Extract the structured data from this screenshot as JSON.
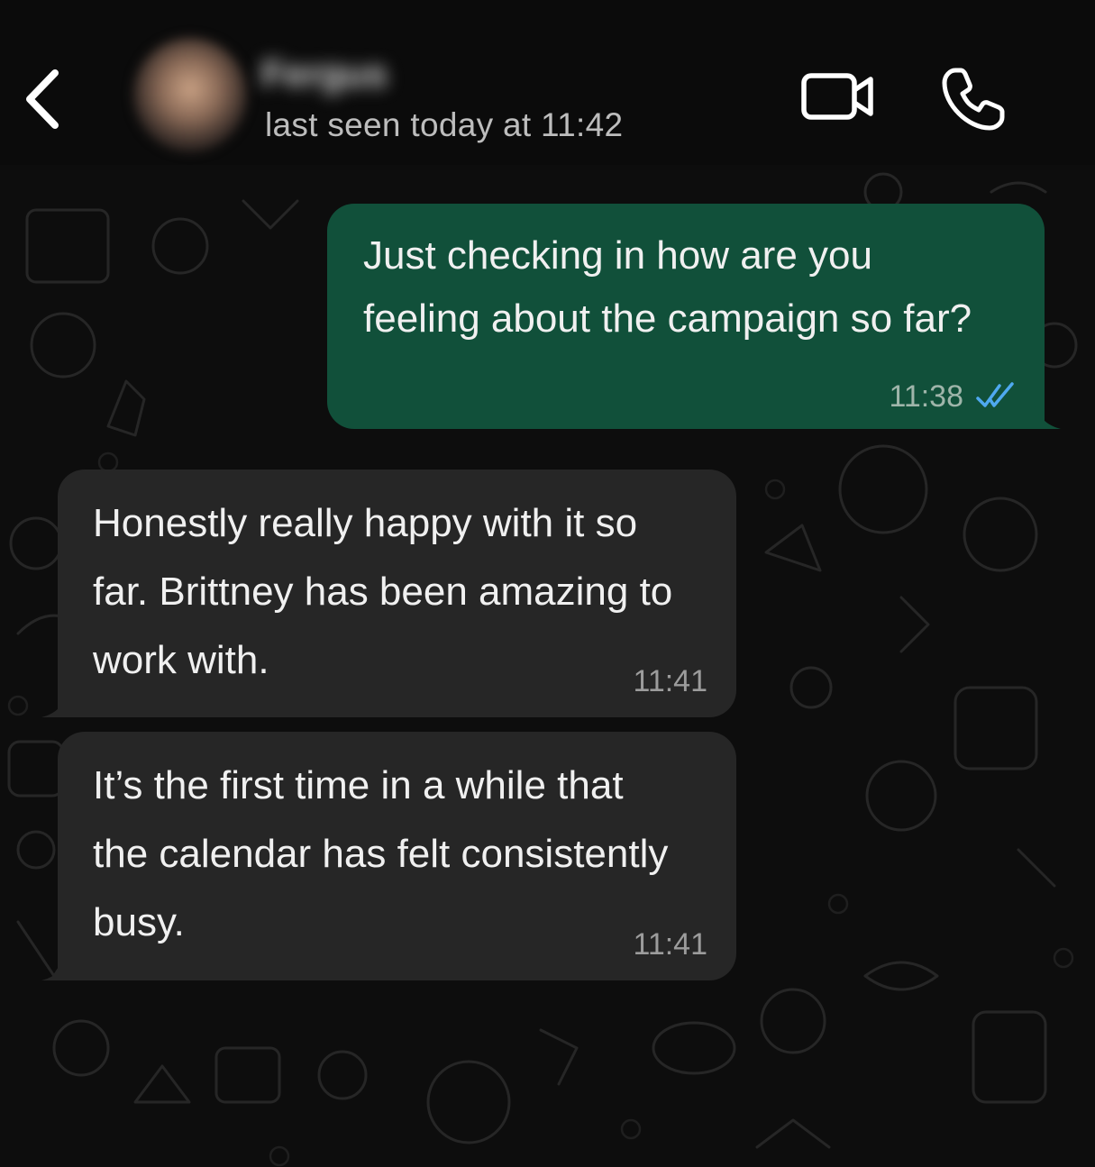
{
  "header": {
    "contact_name": "Fergus",
    "status": "last seen today at 11:42",
    "back_icon": "chevron-left-icon",
    "video_icon": "video-camera-icon",
    "call_icon": "phone-icon"
  },
  "messages": [
    {
      "direction": "outgoing",
      "text": "Just checking in how are you\nfeeling about the campaign so far?",
      "time": "11:38",
      "read_status": "read"
    },
    {
      "direction": "incoming",
      "text": "Honestly really happy with it so\nfar. Brittney has been amazing to\nwork with.",
      "time": "11:41"
    },
    {
      "direction": "incoming",
      "text": "It’s the first time in a while that\nthe calendar has felt consistently\nbusy.",
      "time": "11:41"
    }
  ],
  "colors": {
    "outgoing_bubble": "#11503a",
    "incoming_bubble": "#262626",
    "read_ticks": "#4fa9f0",
    "background": "#0d0d0d"
  }
}
